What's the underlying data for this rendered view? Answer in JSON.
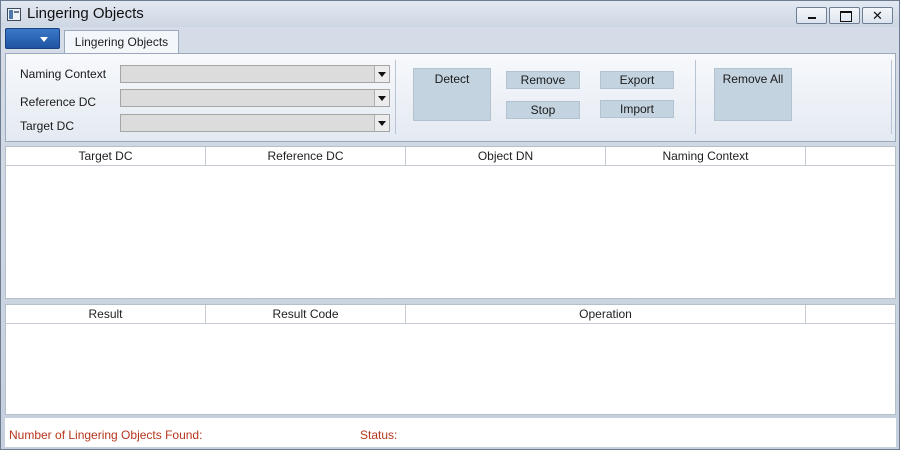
{
  "window": {
    "title": "Lingering Objects"
  },
  "tabs": [
    {
      "label": "Lingering Objects"
    }
  ],
  "form": {
    "naming_context": {
      "label": "Naming Context",
      "value": ""
    },
    "reference_dc": {
      "label": "Reference DC",
      "value": ""
    },
    "target_dc": {
      "label": "Target DC",
      "value": ""
    }
  },
  "actions": {
    "detect": "Detect",
    "remove": "Remove",
    "stop": "Stop",
    "export": "Export",
    "import": "Import",
    "remove_all": "Remove All"
  },
  "objects_grid": {
    "columns": [
      "Target DC",
      "Reference DC",
      "Object DN",
      "Naming Context",
      ""
    ],
    "rows": []
  },
  "results_grid": {
    "columns": [
      "Result",
      "Result Code",
      "Operation",
      ""
    ],
    "rows": []
  },
  "status": {
    "count_label": "Number of Lingering Objects Found:",
    "status_label": "Status:"
  },
  "colors": {
    "status_text": "#b5361d",
    "button_fill": "#c4d3e0",
    "accent": "#1f54a3"
  }
}
